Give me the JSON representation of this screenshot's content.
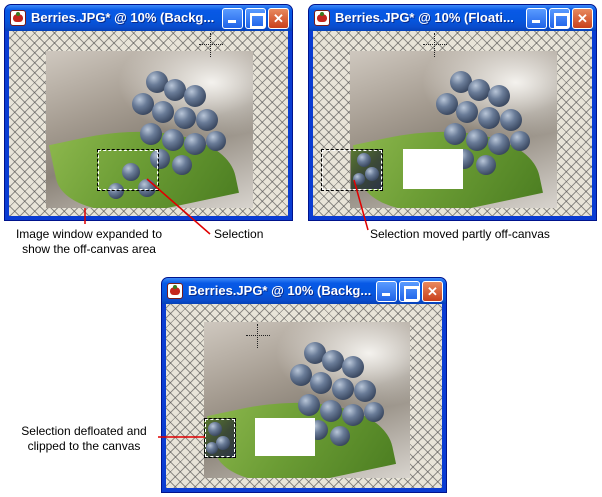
{
  "windows": [
    {
      "title": "Berries.JPG* @  10% (Backg..."
    },
    {
      "title": "Berries.JPG* @  10% (Floati..."
    },
    {
      "title": "Berries.JPG* @  10% (Backg..."
    }
  ],
  "annotations": {
    "expanded_line1": "Image window expanded to",
    "expanded_line2": "show the off-canvas area",
    "selection": "Selection",
    "moved": "Selection moved partly off-canvas",
    "deflated_line1": "Selection defloated and",
    "deflated_line2": "clipped to the canvas"
  },
  "colors": {
    "titlebar": "#0859e6",
    "annotation_line": "#e00000",
    "close_button": "#c9401c"
  },
  "icons": [
    "app-icon",
    "minimize-icon",
    "maximize-icon",
    "close-icon",
    "crosshair-cursor-icon"
  ]
}
